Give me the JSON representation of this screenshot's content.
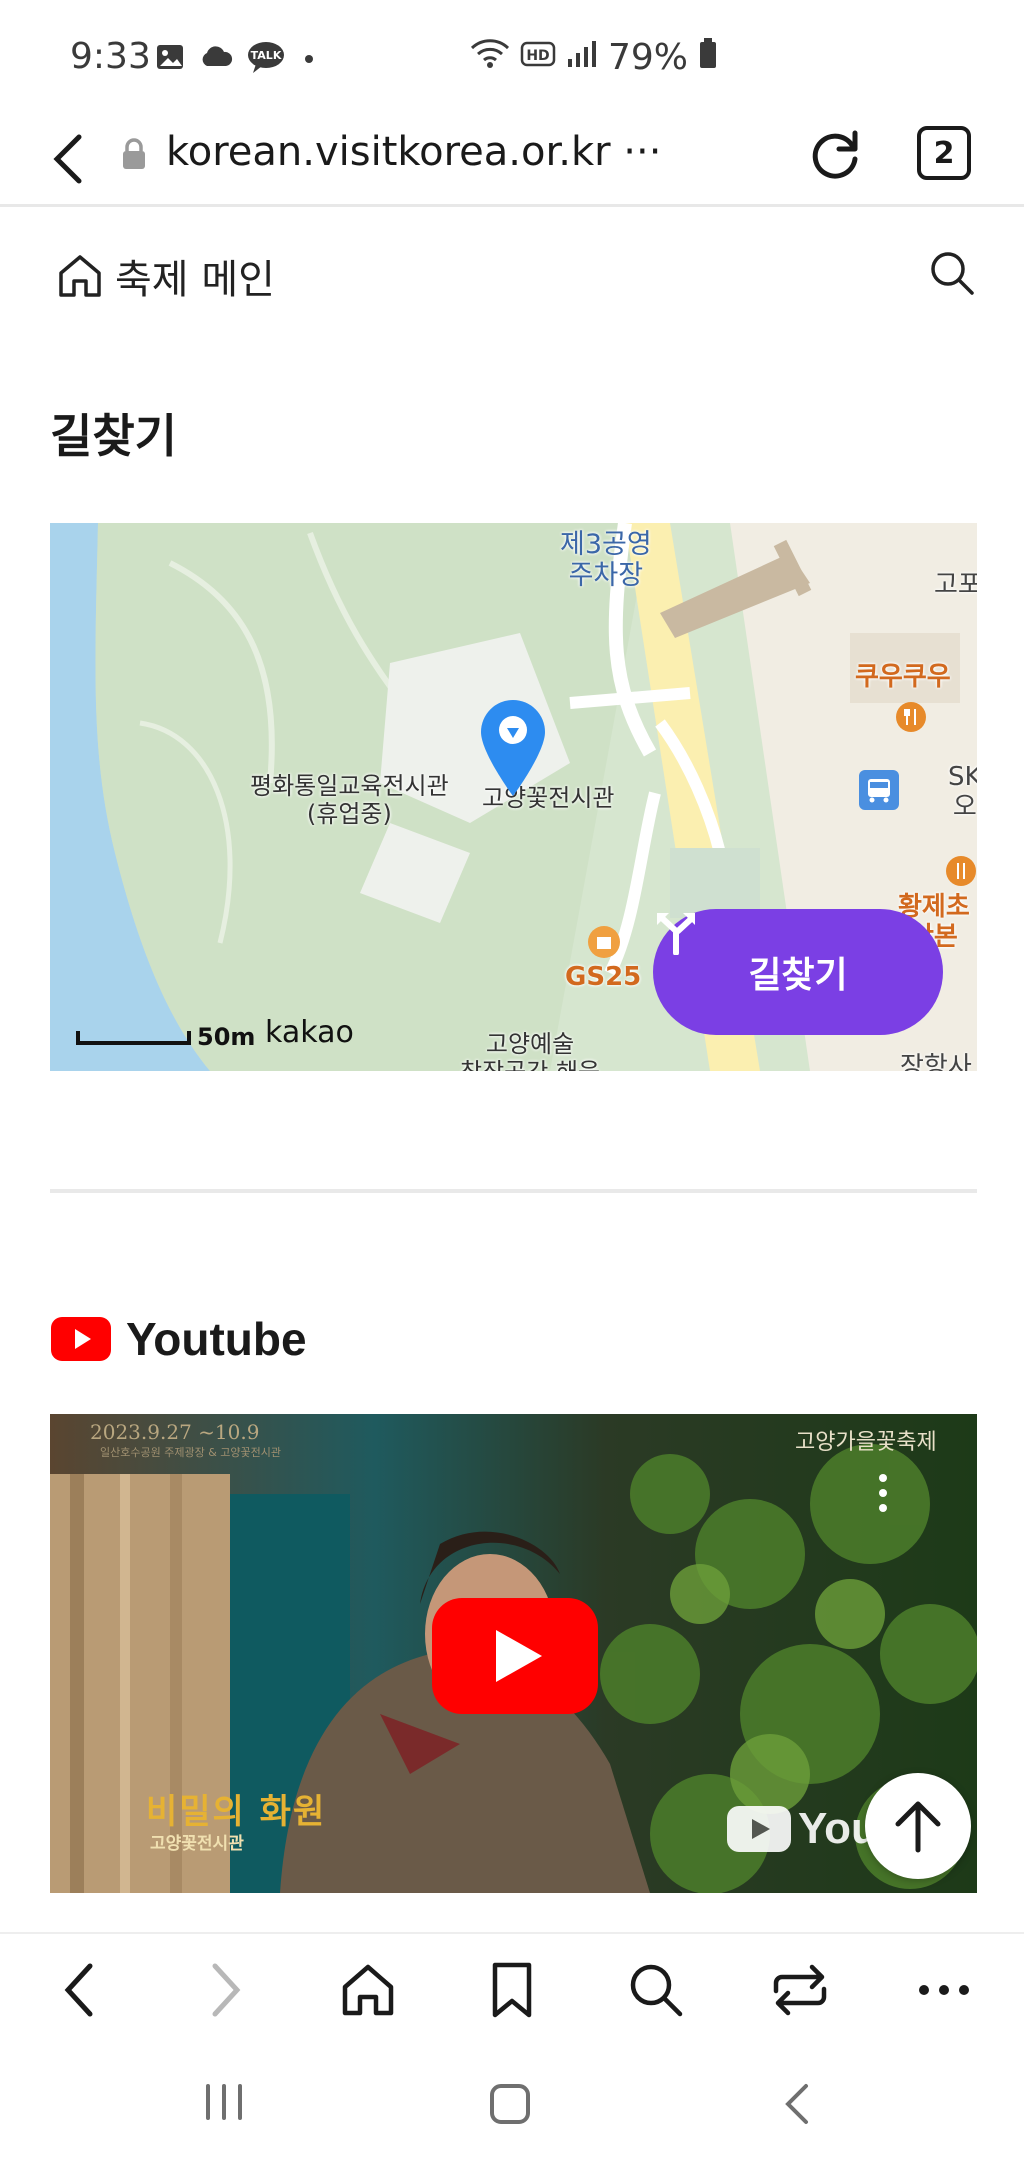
{
  "status_bar": {
    "time": "9:33",
    "battery": "79%",
    "icons": [
      "gallery-icon",
      "cloud-icon",
      "talk-icon",
      "dot-icon",
      "wifi-icon",
      "hd-icon",
      "signal-icon",
      "battery-icon"
    ],
    "talk_label": "TALK",
    "hd_label": "HD"
  },
  "browser": {
    "url": "korean.visitkorea.or.kr ···",
    "tab_count": "2"
  },
  "site_header": {
    "home_label": "축제 메인"
  },
  "directions_section": {
    "title": "길찾기",
    "map": {
      "labels": {
        "parking": "제3공영\n주차장",
        "edge_top_right": "고포",
        "cafe": "쿠우쿠우",
        "museum": "평화통일교육전시관\n(휴업중)",
        "venue": "고양꽃전시관",
        "edge_right_sk": "SK\n오",
        "restaurant": "황제초\n산본",
        "store": "GS25",
        "arts": "고양예술\n창작공간 해움",
        "edge_bottom_right": "장항사"
      },
      "scale_label": "50m",
      "provider": "kakao"
    },
    "directions_button": "길찾기"
  },
  "youtube_section": {
    "title": "Youtube",
    "video": {
      "date_text": "2023.9.27 ~10.9",
      "sub_text": "일산호수공원 주제광장 & 고양꽃전시관",
      "brand_text": "고양가을꽃축제",
      "title_text": "비밀의 화원",
      "caption_text": "고양꽃전시관",
      "watermark": "YouT"
    }
  },
  "bottom_toolbar": [
    "back-icon",
    "forward-icon",
    "home-icon",
    "bookmark-icon",
    "search-icon",
    "tabs-swap-icon",
    "more-icon"
  ],
  "colors": {
    "accent_purple": "#7b3fe4",
    "youtube_red": "#ff0000",
    "map_pin_blue": "#2d8cf0"
  }
}
